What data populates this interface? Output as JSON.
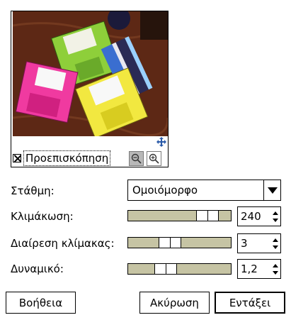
{
  "preview": {
    "toggle_label": "Προεπισκόπηση",
    "checked": true,
    "image_icon": "floppy-disks-photo"
  },
  "form": {
    "alignment": {
      "label": "Στάθμη:",
      "value": "Ομοιόμορφο"
    },
    "scaling": {
      "label": "Κλιμάκωση:",
      "value": "240",
      "slider_level": 0.85
    },
    "scale_division": {
      "label": "Διαίρεση κλίμακας:",
      "value": "3",
      "slider_level": 0.38
    },
    "potential": {
      "label": "Δυναμικό:",
      "value": "1,2",
      "slider_level": 0.33
    }
  },
  "buttons": {
    "help": "Βοήθεια",
    "cancel": "Ακύρωση",
    "ok": "Εντάξει"
  },
  "colors": {
    "slider_track": "#c6c4a4",
    "zoom_out_bg": "#b8b8b8"
  }
}
